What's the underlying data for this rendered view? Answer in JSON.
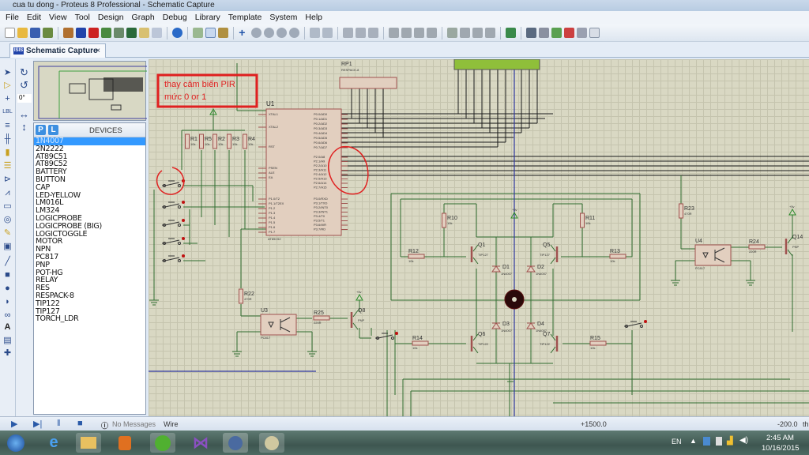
{
  "window": {
    "title": "cua tu dong - Proteus 8 Professional - Schematic Capture"
  },
  "menu": [
    "File",
    "Edit",
    "View",
    "Tool",
    "Design",
    "Graph",
    "Debug",
    "Library",
    "Template",
    "System",
    "Help"
  ],
  "tab": {
    "label": "Schematic Capture",
    "close": "×",
    "icon": "ISIS"
  },
  "rotation": {
    "value": "0°"
  },
  "devices": {
    "header": "DEVICES",
    "p_label": "P",
    "l_label": "L",
    "selected": "1N4007",
    "items": [
      "1N4007",
      "2N2222",
      "AT89C51",
      "AT89C52",
      "BATTERY",
      "BUTTON",
      "CAP",
      "LED-YELLOW",
      "LM016L",
      "LM324",
      "LOGICPROBE",
      "LOGICPROBE (BIG)",
      "LOGICTOGGLE",
      "MOTOR",
      "NPN",
      "PC817",
      "PNP",
      "POT-HG",
      "RELAY",
      "RES",
      "RESPACK-8",
      "TIP122",
      "TIP127",
      "TORCH_LDR"
    ]
  },
  "schematic": {
    "annotation": {
      "line1": "thay cảm biến PIR",
      "line2": "mức 0 or 1"
    },
    "u1": {
      "ref": "U1",
      "part": "AT89C52"
    },
    "rp1": {
      "ref": "RP1",
      "part": "RESPACK-8"
    },
    "resistors": [
      {
        "ref": "R1",
        "val": "10k"
      },
      {
        "ref": "R5",
        "val": "10k"
      },
      {
        "ref": "R2",
        "val": "10k"
      },
      {
        "ref": "R3",
        "val": "10k"
      },
      {
        "ref": "R4",
        "val": "10k"
      },
      {
        "ref": "R10",
        "val": "10k"
      },
      {
        "ref": "R11",
        "val": "10k"
      },
      {
        "ref": "R12",
        "val": "10k"
      },
      {
        "ref": "R13",
        "val": "10k"
      },
      {
        "ref": "R14",
        "val": "10k"
      },
      {
        "ref": "R15",
        "val": "10k"
      },
      {
        "ref": "R22",
        "val": "470R"
      },
      {
        "ref": "R25",
        "val": "220R"
      },
      {
        "ref": "R23",
        "val": "470R"
      },
      {
        "ref": "R24",
        "val": "220R"
      }
    ],
    "transistors": [
      {
        "ref": "Q1",
        "part": "TIP127"
      },
      {
        "ref": "Q5",
        "part": "TIP127"
      },
      {
        "ref": "Q6",
        "part": "TIP122"
      },
      {
        "ref": "Q7",
        "part": "TIP122"
      },
      {
        "ref": "Q8",
        "part": "PNP"
      },
      {
        "ref": "Q14",
        "part": "PNP"
      }
    ],
    "diodes": [
      {
        "ref": "D1",
        "part": "1N4007"
      },
      {
        "ref": "D2",
        "part": "1N4007"
      },
      {
        "ref": "D3",
        "part": "1N4007"
      },
      {
        "ref": "D4",
        "part": "1N4007"
      }
    ],
    "optos": [
      {
        "ref": "U3",
        "part": "PC817"
      },
      {
        "ref": "U4",
        "part": "PC817"
      }
    ],
    "power": "+5v",
    "u1_pins_left": [
      "XTAL1",
      "XTAL2",
      "RST",
      "PSEN",
      "ALE",
      "EA",
      "P1.0/T2",
      "P1.1/T2EX",
      "P1.2",
      "P1.3",
      "P1.4",
      "P1.5",
      "P1.6",
      "P1.7"
    ],
    "u1_pins_right": [
      "P0.0/AD0",
      "P0.1/AD1",
      "P0.2/AD2",
      "P0.3/AD3",
      "P0.4/AD4",
      "P0.5/AD5",
      "P0.6/AD6",
      "P0.7/AD7",
      "P2.0/A8",
      "P2.1/A9",
      "P2.2/A10",
      "P2.3/A11",
      "P2.4/A12",
      "P2.5/A13",
      "P2.6/A14",
      "P2.7/A15",
      "P3.0/RXD",
      "P3.1/TXD",
      "P3.2/INT0",
      "P3.3/INT1",
      "P3.4/T0",
      "P3.5/T1",
      "P3.6/WR",
      "P3.7/RD"
    ]
  },
  "status": {
    "messages": "No Messages",
    "mode": "Wire",
    "x": "+1500.0",
    "y": "-200.0",
    "unit": "th"
  },
  "taskbar": {
    "lang": "EN",
    "time": "2:45 AM",
    "date": "10/16/2015"
  },
  "colors": {
    "canvas": "#d9d8c3",
    "wire": "#2f6b2f",
    "component": "#a0524f",
    "annotation": "#e02020"
  }
}
